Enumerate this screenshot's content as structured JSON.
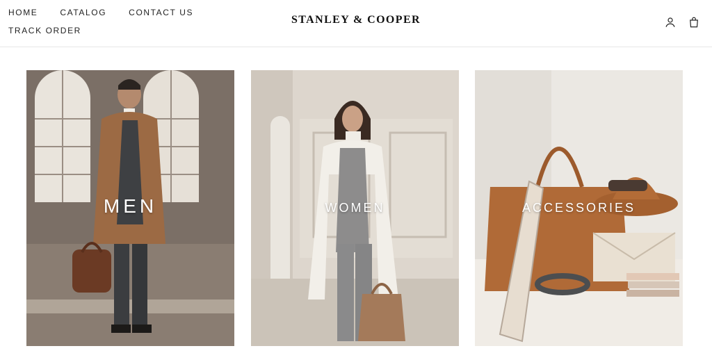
{
  "header": {
    "nav": [
      {
        "label": "HOME"
      },
      {
        "label": "CATALOG"
      },
      {
        "label": "CONTACT US"
      },
      {
        "label": "TRACK ORDER"
      }
    ],
    "brand": "STANLEY & COOPER",
    "icons": [
      "user-icon",
      "shopping-bag-icon"
    ]
  },
  "collections": [
    {
      "label": "MEN"
    },
    {
      "label": "WOMEN"
    },
    {
      "label": "ACCESSORIES"
    }
  ],
  "colors": {
    "text": "#1a1a1a",
    "border": "#e6e6e6",
    "background": "#ffffff"
  }
}
